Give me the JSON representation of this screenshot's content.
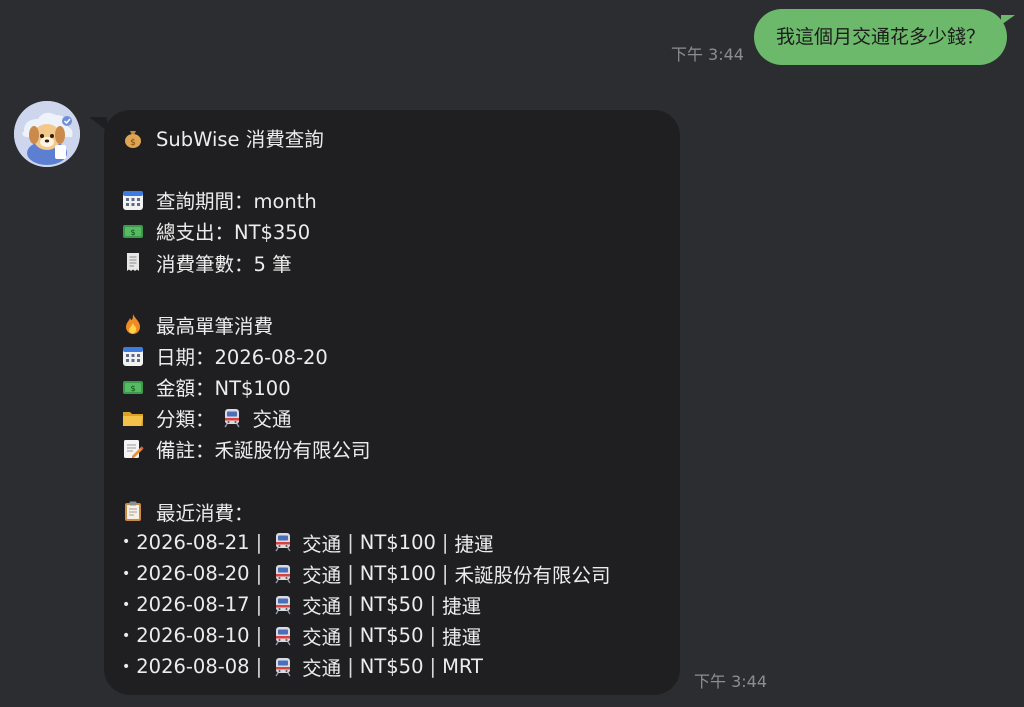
{
  "outgoing": {
    "time": "下午 3:44",
    "text": "我這個月交通花多少錢？"
  },
  "incoming": {
    "time": "下午 3:44",
    "title": "SubWise 消費查詢",
    "summary": {
      "period": "查詢期間：month",
      "total": "總支出：NT$350",
      "count": "消費筆數：5 筆"
    },
    "highest": {
      "heading": "最高單筆消費",
      "date": "日期：2026-08-20",
      "amount": "金額：NT$100",
      "category_label": "分類：",
      "category": "交通",
      "note": "備註：禾誕股份有限公司"
    },
    "recent_heading": "最近消費：",
    "recent": [
      {
        "date": "2026-08-21",
        "category": "交通",
        "amount": "NT$100",
        "note": "捷運"
      },
      {
        "date": "2026-08-20",
        "category": "交通",
        "amount": "NT$100",
        "note": "禾誕股份有限公司"
      },
      {
        "date": "2026-08-17",
        "category": "交通",
        "amount": "NT$50",
        "note": "捷運"
      },
      {
        "date": "2026-08-10",
        "category": "交通",
        "amount": "NT$50",
        "note": "捷運"
      },
      {
        "date": "2026-08-08",
        "category": "交通",
        "amount": "NT$50",
        "note": "MRT"
      }
    ],
    "bullet": "•",
    "separator": "|"
  },
  "icons": {
    "title": "money-bag-icon",
    "period": "calendar-icon",
    "total": "banknote-icon",
    "count": "receipt-icon",
    "highest": "fire-icon",
    "date": "calendar-icon",
    "amount": "banknote-icon",
    "category": "folder-icon",
    "note": "memo-icon",
    "recent": "clipboard-icon",
    "transport": "train-icon"
  },
  "colors": {
    "background": "#2b2d30",
    "outgoing_bubble": "#6cb96b",
    "incoming_bubble": "#1f1f21",
    "timestamp": "#8b8d91"
  }
}
